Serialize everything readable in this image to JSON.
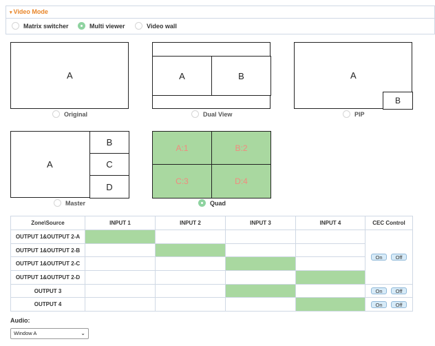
{
  "panel": {
    "title": "Video Mode",
    "caret": "▾"
  },
  "modes": [
    {
      "label": "Matrix switcher",
      "selected": false
    },
    {
      "label": "Multi viewer",
      "selected": true
    },
    {
      "label": "Video wall",
      "selected": false
    }
  ],
  "layouts": {
    "original": {
      "label": "Original",
      "cells": [
        "A"
      ]
    },
    "dual_view": {
      "label": "Dual View",
      "cells": [
        "A",
        "B"
      ]
    },
    "pip": {
      "label": "PIP",
      "cells": [
        "A",
        "B"
      ]
    },
    "master": {
      "label": "Master",
      "cells": [
        "A",
        "B",
        "C",
        "D"
      ]
    },
    "quad": {
      "label": "Quad",
      "cells": [
        "A:1",
        "B:2",
        "C:3",
        "D:4"
      ],
      "selected": true
    }
  },
  "matrix": {
    "headers": [
      "Zone\\Source",
      "INPUT 1",
      "INPUT 2",
      "INPUT 3",
      "INPUT 4",
      "CEC Control"
    ],
    "rows": [
      {
        "zone": "OUTPUT 1&OUTPUT 2-A",
        "active_input": 1
      },
      {
        "zone": "OUTPUT 1&OUTPUT 2-B",
        "active_input": 2
      },
      {
        "zone": "OUTPUT 1&OUTPUT 2-C",
        "active_input": 3
      },
      {
        "zone": "OUTPUT 1&OUTPUT 2-D",
        "active_input": 4
      },
      {
        "zone": "OUTPUT 3",
        "active_input": 3
      },
      {
        "zone": "OUTPUT 4",
        "active_input": 4
      }
    ],
    "on_label": "On",
    "off_label": "Off",
    "active_color": "#a9d8a0"
  },
  "audio": {
    "label": "Audio:",
    "selected": "Window A"
  },
  "colors": {
    "accent": "#e8862a",
    "quad_fill": "#a9d8a0",
    "quad_text": "#f28a7e",
    "radio_selected": "#8fd3a0"
  }
}
